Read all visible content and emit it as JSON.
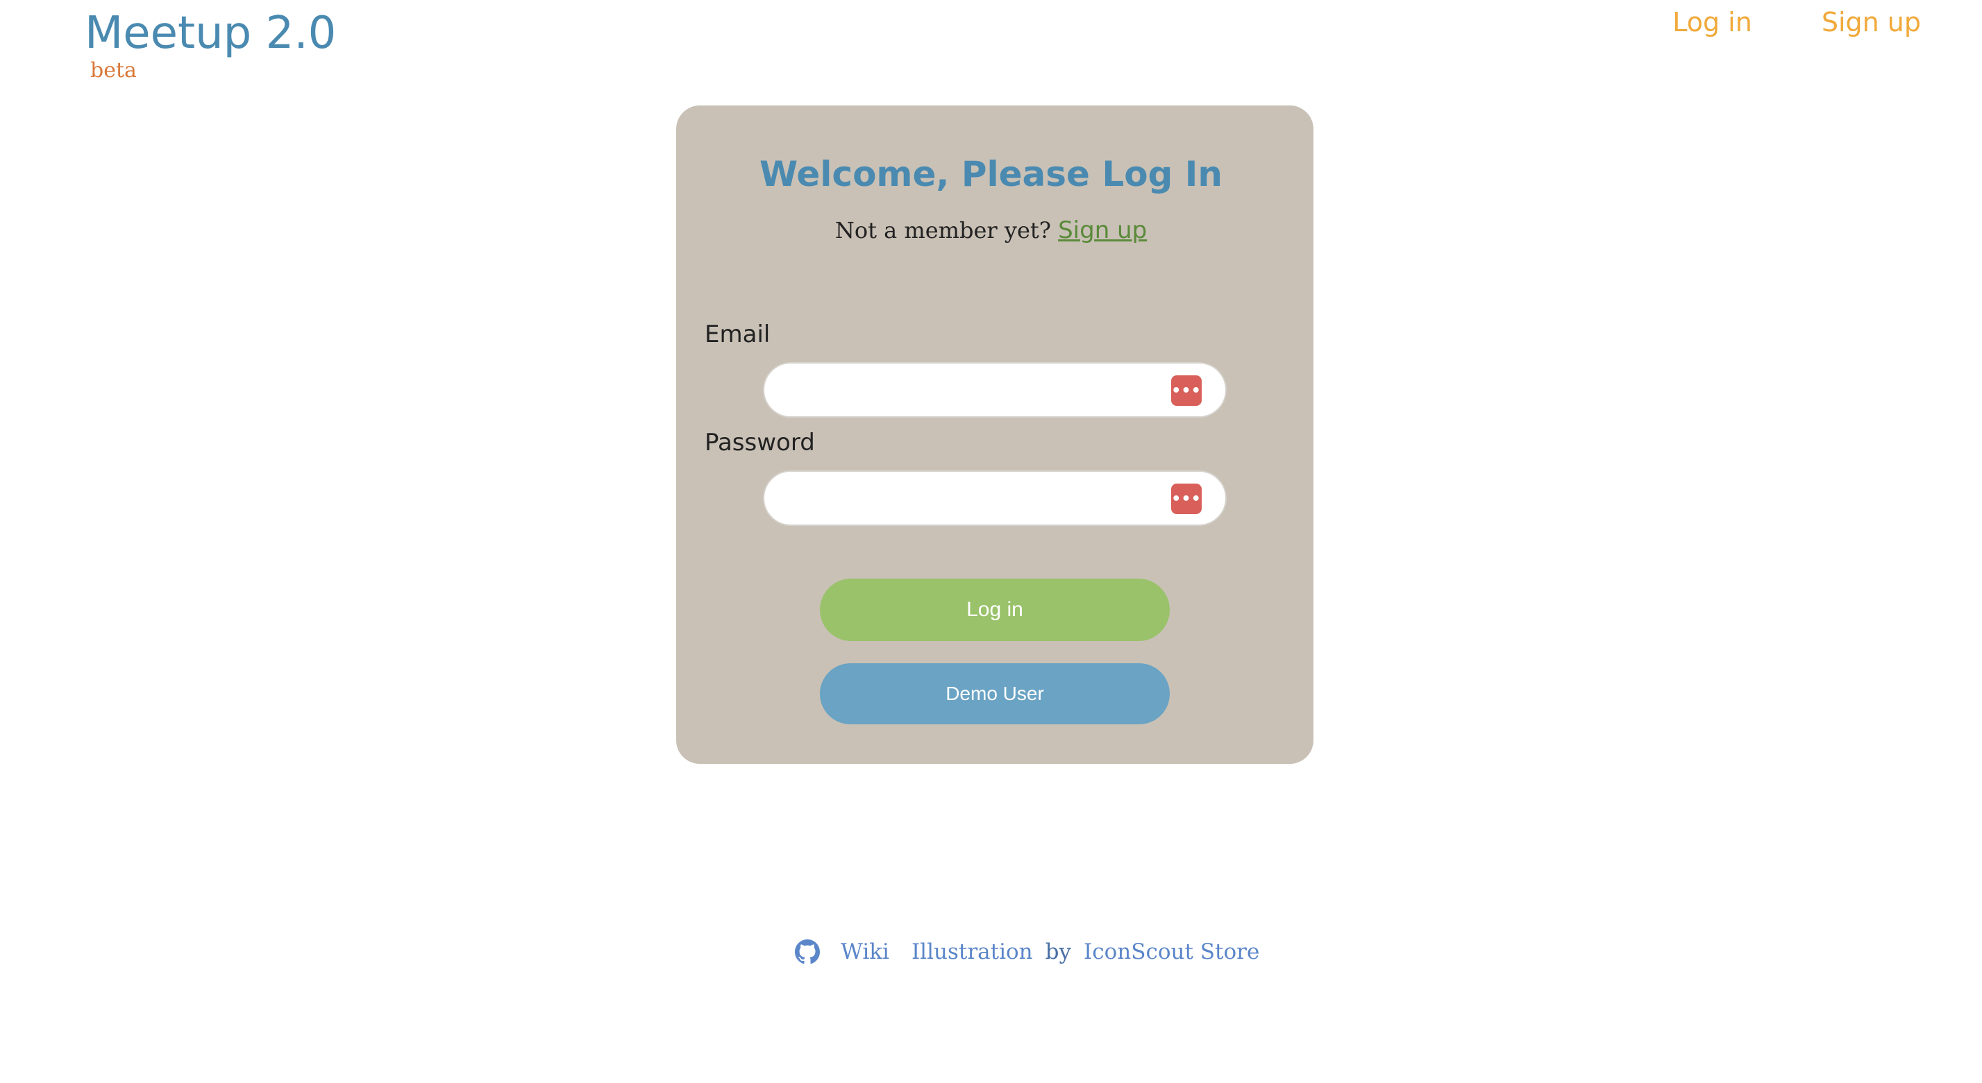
{
  "header": {
    "brand_title": "Meetup 2.0",
    "brand_badge": "beta",
    "nav": {
      "login_label": "Log in",
      "signup_label": "Sign up"
    }
  },
  "login_form": {
    "title": "Welcome, Please Log In",
    "signup_prompt": "Not a member yet?",
    "signup_link": "Sign up",
    "email_label": "Email",
    "email_value": "",
    "password_label": "Password",
    "password_value": "",
    "password_manager_icon": "password-manager-icon",
    "login_button": "Log in",
    "demo_button": "Demo User"
  },
  "footer": {
    "github_icon": "github-icon",
    "wiki_link": "Wiki",
    "illustration_link": "Illustration",
    "by_text": "by",
    "store_link": "IconScout Store"
  },
  "colors": {
    "brand_blue": "#4a8ab0",
    "nav_orange": "#f0a93a",
    "card_bg": "#c9c1b6",
    "login_green": "#99c26a",
    "demo_blue": "#6aa3c3",
    "icon_red": "#d9605a"
  }
}
